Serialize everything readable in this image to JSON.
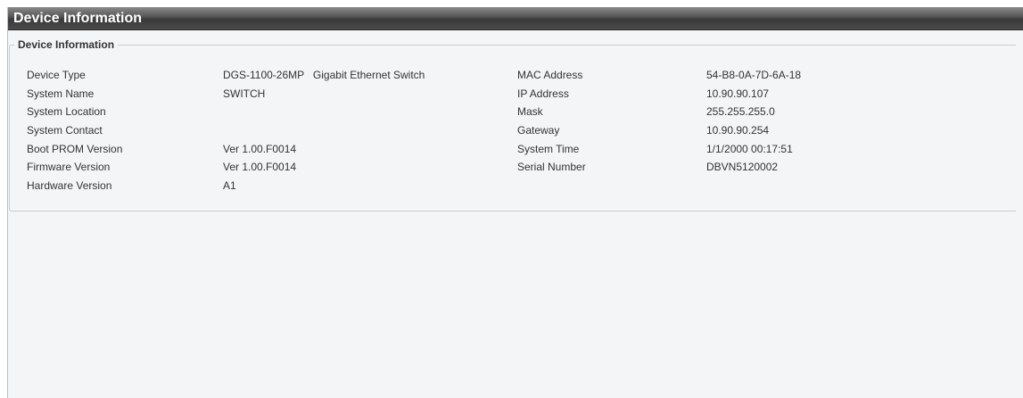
{
  "header": {
    "title": "Device Information"
  },
  "section": {
    "legend": "Device Information"
  },
  "rows": [
    {
      "label_left": "Device Type",
      "value_left": "DGS-1100-26MP   Gigabit Ethernet Switch",
      "label_right": "MAC Address",
      "value_right": "54-B8-0A-7D-6A-18"
    },
    {
      "label_left": "System Name",
      "value_left": "SWITCH",
      "label_right": "IP Address",
      "value_right": "10.90.90.107"
    },
    {
      "label_left": "System Location",
      "value_left": "",
      "label_right": "Mask",
      "value_right": "255.255.255.0"
    },
    {
      "label_left": "System Contact",
      "value_left": "",
      "label_right": "Gateway",
      "value_right": "10.90.90.254"
    },
    {
      "label_left": "Boot PROM Version",
      "value_left": "Ver 1.00.F0014",
      "label_right": "System Time",
      "value_right": "1/1/2000 00:17:51"
    },
    {
      "label_left": "Firmware Version",
      "value_left": "Ver 1.00.F0014",
      "label_right": "Serial Number",
      "value_right": "DBVN5120002"
    },
    {
      "label_left": "Hardware Version",
      "value_left": "A1",
      "label_right": "",
      "value_right": ""
    }
  ],
  "colors": {
    "title_bar": "#4a4a4a",
    "panel_background": "#f4f5f7",
    "text": "#333333"
  }
}
